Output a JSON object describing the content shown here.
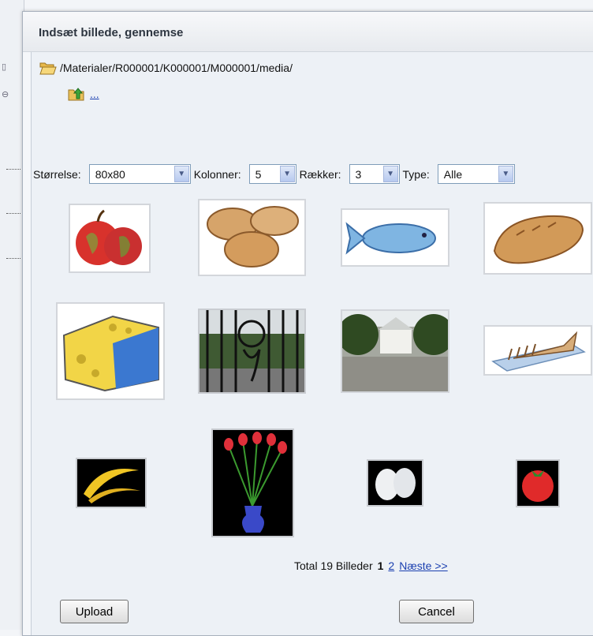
{
  "dialog": {
    "title": "Indsæt billede, gennemse"
  },
  "browser": {
    "path": "/Materialer/R000001/K000001/M000001/media/",
    "up_link": "..."
  },
  "controls": {
    "size_label": "Størrelse:",
    "size_value": "80x80",
    "columns_label": "Kolonner:",
    "columns_value": "5",
    "rows_label": "Rækker:",
    "rows_value": "3",
    "type_label": "Type:",
    "type_value": "Alle"
  },
  "images": [
    {
      "name": "apples-image",
      "icon": "apples"
    },
    {
      "name": "potatoes-image",
      "icon": "potatoes"
    },
    {
      "name": "fish-image",
      "icon": "fish"
    },
    {
      "name": "bread-image",
      "icon": "bread"
    },
    {
      "name": "cheese-image",
      "icon": "cheese"
    },
    {
      "name": "gate-image",
      "icon": "gate"
    },
    {
      "name": "manor-image",
      "icon": "manor"
    },
    {
      "name": "sliced-bread-image",
      "icon": "sliced-bread"
    },
    {
      "name": "bananas-image",
      "icon": "bananas"
    },
    {
      "name": "tulips-vase-image",
      "icon": "tulips"
    },
    {
      "name": "eggs-image",
      "icon": "eggs"
    },
    {
      "name": "tomato-image",
      "icon": "tomato"
    }
  ],
  "pager": {
    "total_text": "Total 19 Billeder",
    "current_page": "1",
    "page_2": "2",
    "next": "Næste >>"
  },
  "buttons": {
    "upload": "Upload",
    "cancel": "Cancel"
  }
}
